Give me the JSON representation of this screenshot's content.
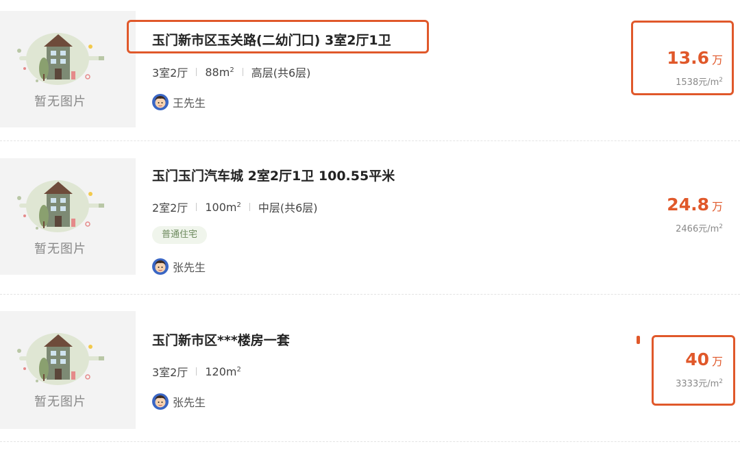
{
  "listings": [
    {
      "thumb_label": "暂无图片",
      "title": "玉门新市区玉关路(二幼门口) 3室2厅1卫",
      "layout": "3室2厅",
      "area_num": "88m",
      "area_sup": "2",
      "floor": "高层(共6层)",
      "agent": "王先生",
      "price": "13.6",
      "price_unit": "万",
      "unit_price": "1538元/m",
      "unit_price_sup": "2"
    },
    {
      "thumb_label": "暂无图片",
      "title": "玉门玉门汽车城 2室2厅1卫 100.55平米",
      "layout": "2室2厅",
      "area_num": "100m",
      "area_sup": "2",
      "floor": "中层(共6层)",
      "tag": "普通住宅",
      "agent": "张先生",
      "price": "24.8",
      "price_unit": "万",
      "unit_price": "2466元/m",
      "unit_price_sup": "2"
    },
    {
      "thumb_label": "暂无图片",
      "title": "玉门新市区***楼房一套",
      "layout": "3室2厅",
      "area_num": "120m",
      "area_sup": "2",
      "agent": "张先生",
      "price": "40",
      "price_unit": "万",
      "unit_price": "3333元/m",
      "unit_price_sup": "2"
    }
  ],
  "colors": {
    "accent": "#e0582a",
    "tag_bg": "#f0f5ec",
    "tag_text": "#6d8a5d",
    "thumb_bg": "#f3f3f3"
  },
  "icons": {
    "placeholder": "house-placeholder-icon",
    "agent": "agent-avatar-icon"
  }
}
